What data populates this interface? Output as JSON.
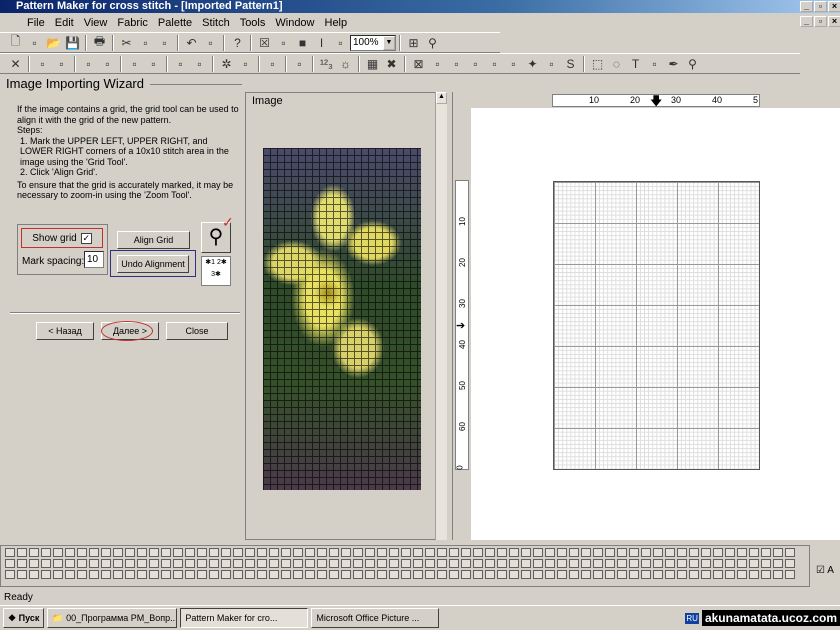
{
  "window": {
    "title": "Pattern Maker for cross stitch - [Imported Pattern1]"
  },
  "menu": [
    "File",
    "Edit",
    "View",
    "Fabric",
    "Palette",
    "Stitch",
    "Tools",
    "Window",
    "Help"
  ],
  "toolbar1": {
    "icons": [
      "new-icon",
      "import-icon",
      "open-icon",
      "save-icon",
      "print-icon",
      "cut-icon",
      "copy-icon",
      "paste-icon",
      "undo-icon",
      "redo-icon",
      "help-icon",
      "cross-view-icon",
      "symbol-view-icon",
      "color-view-icon",
      "text-view-icon",
      "calendar-icon"
    ],
    "zoom": "100%",
    "extra": [
      "fit-icon",
      "zoom-find-icon"
    ]
  },
  "toolbar2": {
    "icons": [
      "delete-icon",
      "fill-icon",
      "replace-icon",
      "flip-h-icon",
      "flip-v-icon",
      "rotate-left-icon",
      "rotate-right-icon",
      "stitch-icon",
      "stitch2-icon",
      "star-icon",
      "mirror-icon",
      "select-icon",
      "palette-icon",
      "numbers-icon",
      "sun-icon",
      "grid-icon",
      "cross-stitch-icon",
      "full-stitch-icon",
      "half-stitch-icon",
      "quarter-stitch-icon",
      "three-quarter-icon",
      "back-stitch-icon",
      "long-stitch-icon",
      "knot-icon",
      "bead-icon",
      "special-stitch-icon",
      "rect-select-icon",
      "lasso-icon",
      "text-tool-icon",
      "eraser-icon",
      "picker-icon",
      "zoom-icon"
    ]
  },
  "wizard": {
    "title": "Image Importing Wizard",
    "intro": "If the image contains a grid, the grid tool can be used to align it with the grid of the new pattern.",
    "steps_label": "Steps:",
    "step1": "1. Mark the UPPER LEFT, UPPER RIGHT, and LOWER RIGHT corners of a 10x10 stitch area in the image using the 'Grid Tool'.",
    "step2": "2. Click 'Align Grid'.",
    "note": "To ensure that the grid is accurately marked, it may be necessary to zoom-in using the 'Zoom Tool'.",
    "show_grid_label": "Show grid",
    "show_grid": true,
    "mark_spacing_label": "Mark spacing:",
    "mark_spacing": "10",
    "align_grid": "Align Grid",
    "undo_alignment": "Undo Alignment",
    "back": "< Назад",
    "next": "Далее >",
    "close": "Close"
  },
  "image_panel": {
    "label": "Image"
  },
  "ruler": {
    "h": [
      "10",
      "20",
      "30",
      "40",
      "5"
    ],
    "v": [
      "10",
      "20",
      "30",
      "40",
      "50",
      "60",
      "0"
    ]
  },
  "status": "Ready",
  "taskbar": {
    "start": "Пуск",
    "tasks": [
      "00_Программа PM_Вопр...",
      "Pattern Maker for cro...",
      "Microsoft Office Picture ..."
    ],
    "lang": "RU",
    "watermark": "akunamatata.ucoz.com"
  },
  "colors": {
    "title": "#0a246a",
    "highlight_red": "#c03030",
    "highlight_blue": "#303080"
  }
}
